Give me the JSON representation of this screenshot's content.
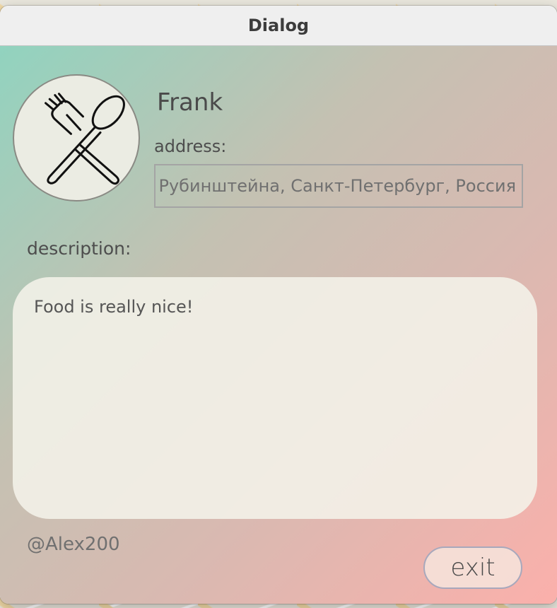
{
  "window": {
    "title": "Dialog"
  },
  "restaurant": {
    "name": "Frank",
    "logo_icon": "fork-and-spoon-icon",
    "address_label": "address:",
    "address_value": "ца Рубинштейна, Санкт-Петербург, Россия",
    "description_label": "description:",
    "description_text": "Food is really nice!",
    "author": "@Alex200"
  },
  "actions": {
    "exit_label": "exit"
  },
  "colors": {
    "gradient_start": "#91d3bf",
    "gradient_end": "#fbb0ab",
    "panel": "#f4f2e9"
  }
}
